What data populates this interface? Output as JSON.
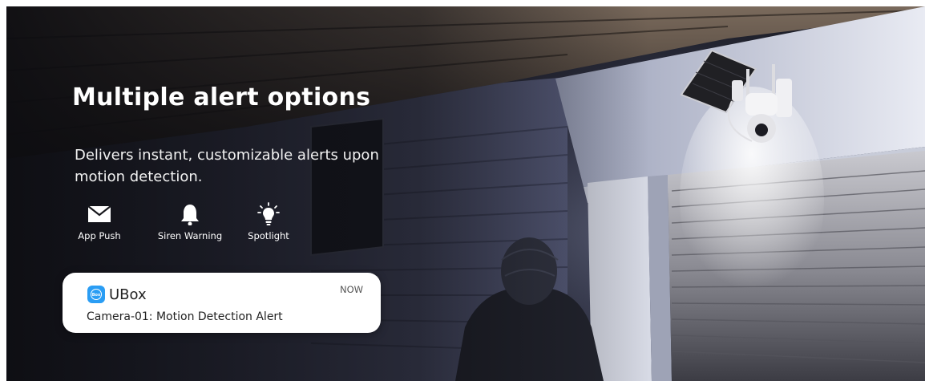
{
  "banner": {
    "headline": "Multiple alert options",
    "subtext": "Delivers instant, customizable alerts upon motion detection."
  },
  "features": [
    {
      "label": "App Push",
      "icon": "envelope-icon"
    },
    {
      "label": "Siren Warning",
      "icon": "bell-icon"
    },
    {
      "label": "Spotlight",
      "icon": "light-bulb-icon"
    }
  ],
  "notification": {
    "app_name": "UBox",
    "time": "NOW",
    "message": "Camera-01: Motion Detection Alert",
    "accent": "#2a9df4"
  }
}
